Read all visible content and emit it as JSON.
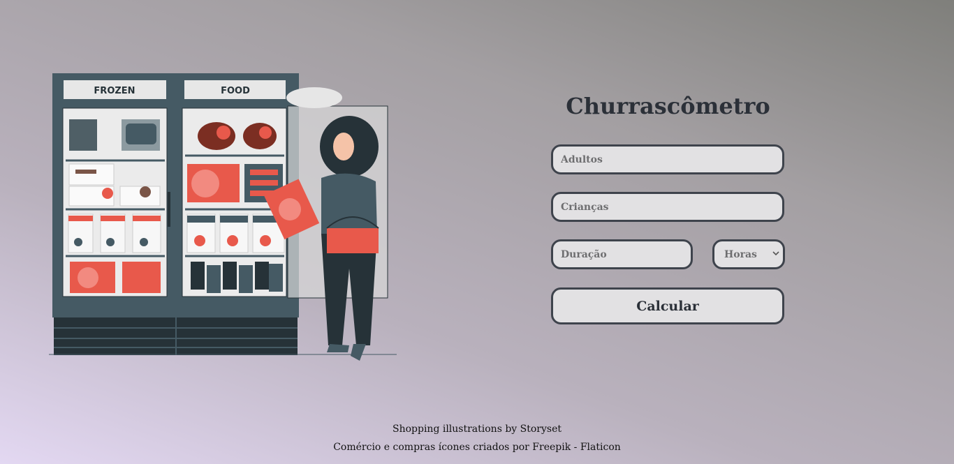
{
  "illustration": {
    "sign_left": "FROZEN",
    "sign_right": "FOOD"
  },
  "form": {
    "title": "Churrascômetro",
    "adults_placeholder": "Adultos",
    "children_placeholder": "Crianças",
    "duration_placeholder": "Duração",
    "unit_selected": "Horas",
    "submit_label": "Calcular"
  },
  "footer": {
    "line1_a": "Shopping illustrations",
    "line1_b": " by Storyset",
    "line2_a": "Comércio e compras ícones criados por Freepik - Flaticon"
  },
  "colors": {
    "fridge": "#455a64",
    "accent": "#e8594b",
    "field_border": "#3e434c",
    "field_bg": "#e2e1e3"
  }
}
